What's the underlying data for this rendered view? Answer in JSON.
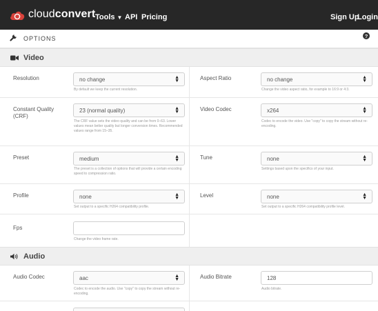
{
  "brand": {
    "name_regular": "cloud",
    "name_bold": "convert"
  },
  "nav": {
    "tools": "Tools",
    "api": "API",
    "pricing": "Pricing",
    "signup": "Sign Up",
    "login": "Login"
  },
  "options": {
    "title": "OPTIONS"
  },
  "video": {
    "title": "Video",
    "resolution": {
      "label": "Resolution",
      "value": "no change",
      "help": "By default we keep the current resolution."
    },
    "aspect_ratio": {
      "label": "Aspect Ratio",
      "value": "no change",
      "help": "Change the video aspect ratio, for example to 16:9 or 4:3."
    },
    "crf": {
      "label": "Constant Quality (CRF)",
      "value": "23 (normal quality)",
      "help": "The CRF value sets the video quality and can be from 0–63. Lower values mean better quality but longer conversion times. Recommended values range from 15–35."
    },
    "codec": {
      "label": "Video Codec",
      "value": "x264",
      "help": "Codec to encode the video. Use \"copy\" to copy the stream without re-encoding."
    },
    "preset": {
      "label": "Preset",
      "value": "medium",
      "help": "The preset is a collection of options that will provide a certain encoding speed to compression ratio."
    },
    "tune": {
      "label": "Tune",
      "value": "none",
      "help": "Settings based upon the specifics of your input."
    },
    "profile": {
      "label": "Profile",
      "value": "none",
      "help": "Set output to a specific H264 compatibility profile."
    },
    "level": {
      "label": "Level",
      "value": "none",
      "help": "Set output to a specific H264 compatibility profile level."
    },
    "fps": {
      "label": "Fps",
      "value": "",
      "help": "Change the video frame rate."
    }
  },
  "audio": {
    "title": "Audio",
    "codec": {
      "label": "Audio Codec",
      "value": "aac",
      "help": "Codec to encode the audio. Use \"copy\" to copy the stream without re-encoding."
    },
    "bitrate": {
      "label": "Audio Bitrate",
      "value": "128",
      "help": "Audio bitrate."
    }
  }
}
